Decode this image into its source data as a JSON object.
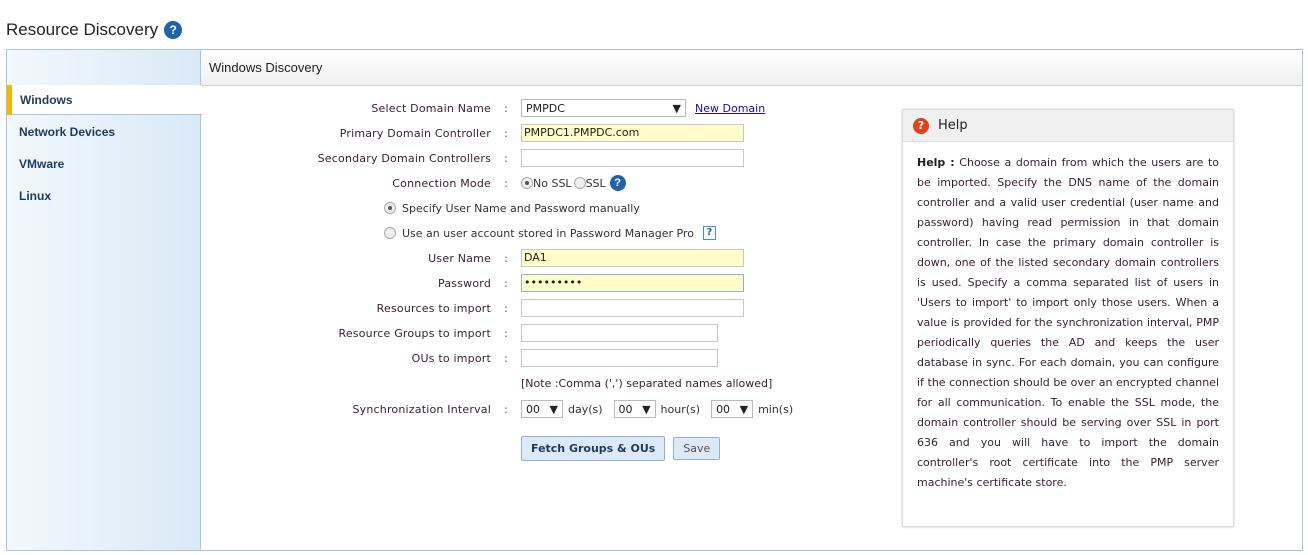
{
  "page": {
    "title": "Resource Discovery"
  },
  "sidebar": {
    "items": [
      {
        "label": "Windows",
        "active": true
      },
      {
        "label": "Network Devices"
      },
      {
        "label": "VMware"
      },
      {
        "label": "Linux"
      }
    ]
  },
  "panel": {
    "title": "Windows Discovery"
  },
  "form": {
    "domain_label": "Select Domain Name",
    "domain_value": "PMPDC",
    "new_domain": "New Domain",
    "primary_label": "Primary Domain Controller",
    "primary_value": "PMPDC1.PMPDC.com",
    "secondary_label": "Secondary Domain Controllers",
    "secondary_value": "",
    "conn_label": "Connection Mode",
    "no_ssl": "No SSL",
    "ssl": "SSL",
    "manual_option": "Specify User Name and Password manually",
    "stored_option": "Use an user account stored in Password Manager Pro",
    "user_label": "User Name",
    "user_value": "DA1",
    "password_label": "Password",
    "password_value": "•••••••••",
    "resources_label": "Resources to import",
    "groups_label": "Resource Groups to import",
    "ous_label": "OUs to import",
    "note": "[Note :Comma (',') separated names allowed]",
    "sync_label": "Synchronization Interval",
    "days": "00",
    "days_unit": "day(s)",
    "hours": "00",
    "hours_unit": "hour(s)",
    "mins": "00",
    "mins_unit": "min(s)",
    "fetch_button": "Fetch Groups & OUs",
    "save_button": "Save",
    "colon": ":"
  },
  "help": {
    "title": "Help",
    "lead": "Help :",
    "text": "Choose a domain from which the users are to be imported. Specify the DNS name of the domain controller and a valid user credential (user name and password) having read permission in that domain controller. In case the primary domain controller is down, one of the listed secondary domain controllers is used. Specify a comma separated list of users in 'Users to import' to import only those users. When a value is provided for the synchronization interval, PMP periodically queries the AD and keeps the user database in sync. For each domain, you can configure if the connection should be over an encrypted channel for all communication. To enable the SSL mode, the domain controller should be serving over SSL in port 636 and you will have to import the domain controller's root certificate into the PMP server machine's certificate store."
  }
}
